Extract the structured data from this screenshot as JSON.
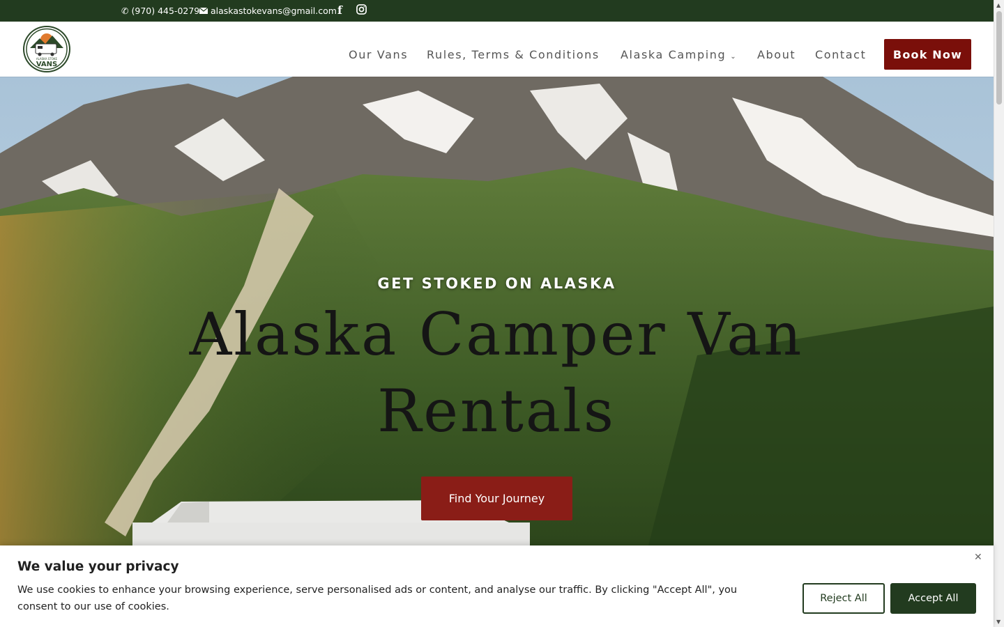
{
  "topbar": {
    "phone": "(970) 445-0279",
    "email": "alaskastokevans@gmail.com",
    "facebook_icon": "facebook-icon",
    "instagram_icon": "instagram-icon",
    "bg_color": "#223b1f"
  },
  "header": {
    "logo_top_text": "ALASKA STOKE",
    "logo_main_text": "VANS",
    "nav": [
      {
        "label": "Our Vans"
      },
      {
        "label": "Rules, Terms & Conditions"
      },
      {
        "label": "Alaska Camping",
        "has_dropdown": true
      },
      {
        "label": "About"
      },
      {
        "label": "Contact"
      }
    ],
    "book_label": "Book Now",
    "book_color": "#7a0f0a"
  },
  "hero": {
    "kicker": "GET STOKED ON ALASKA",
    "headline": "Alaska Camper Van Rentals",
    "cta_label": "Find Your Journey",
    "cta_color": "#8a1d17"
  },
  "cookie": {
    "title": "We value your privacy",
    "text": "We use cookies to enhance your browsing experience, serve personalised ads or content, and analyse our traffic. By clicking \"Accept All\", you consent to our use of cookies.",
    "reject_label": "Reject All",
    "accept_label": "Accept All",
    "close_icon": "close-icon"
  }
}
